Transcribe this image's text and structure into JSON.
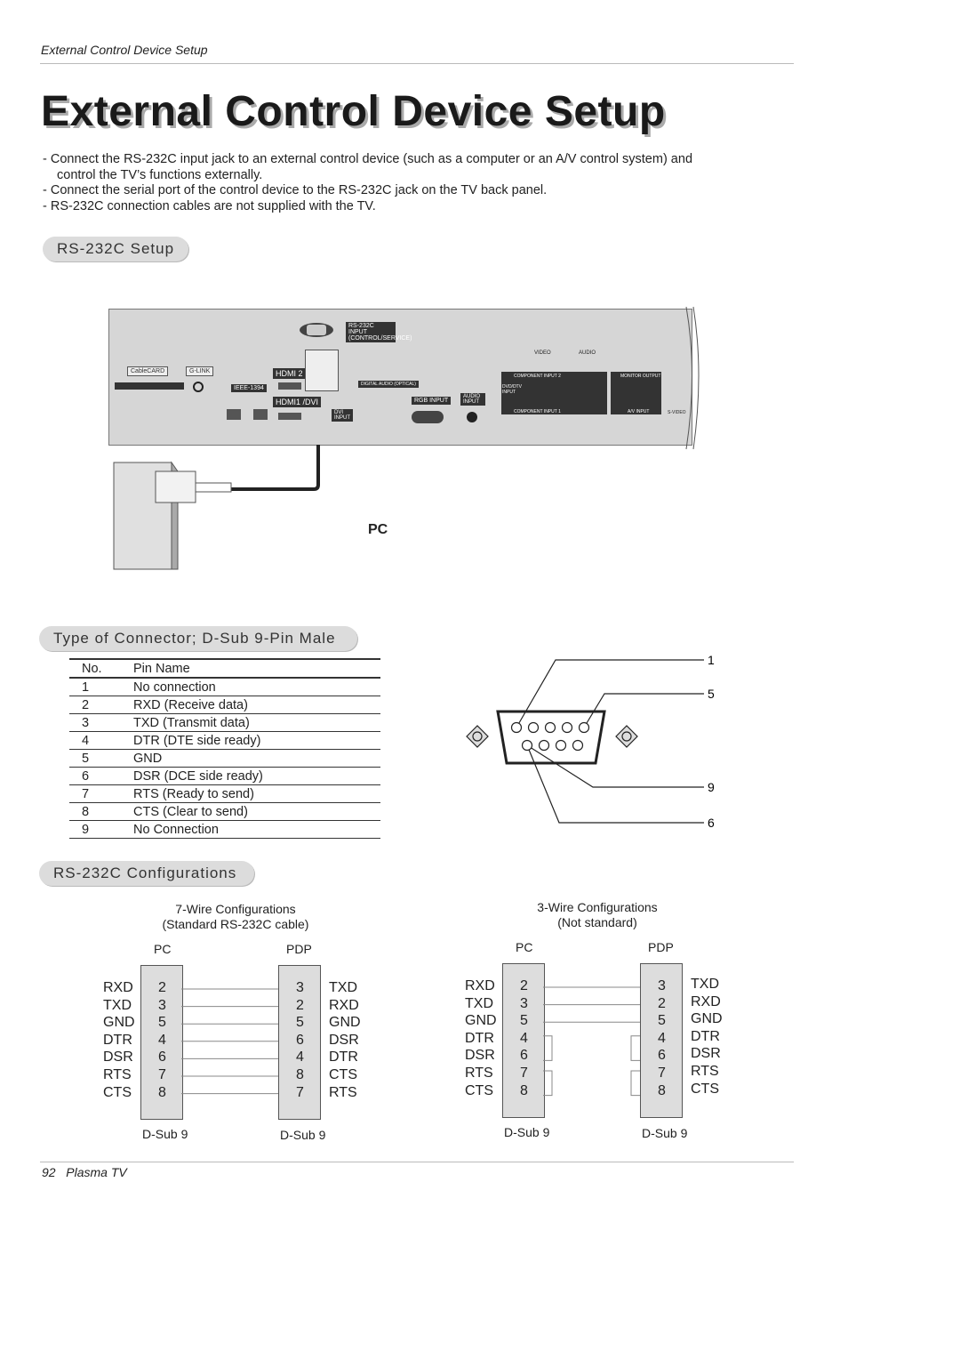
{
  "header": {
    "running_title": "External Control Device Setup"
  },
  "title": "External Control Device Setup",
  "bullets": [
    "- Connect the RS-232C input jack to an external control device (such as a computer or an A/V control system) and control the TV’s functions externally.",
    "- Connect the serial port of the control device to the RS-232C jack on the TV back panel.",
    "- RS-232C connection cables are not supplied with the TV."
  ],
  "sections": {
    "setup": "RS-232C Setup",
    "connector": "Type of Connector; D-Sub 9-Pin Male",
    "configs": "RS-232C Configurations"
  },
  "panel": {
    "rs232": "RS-232C INPUT (CONTROL/SERVICE)",
    "cablecard": "CableCARD",
    "glink": "G-LINK",
    "ieee": "IEEE-1394",
    "hdmi2": "HDMI 2",
    "hdmi1": "HDMI1 /DVI",
    "dvi": "DVI INPUT",
    "optical": "DIGITAL AUDIO (OPTICAL)",
    "rgb": "RGB INPUT",
    "audio_in": "AUDIO INPUT",
    "video": "VIDEO",
    "audio": "AUDIO",
    "comp2": "COMPONENT INPUT 2",
    "comp1": "COMPONENT INPUT 1",
    "monitor": "MONITOR OUTPUT",
    "av": "A/V INPUT",
    "svideo": "S-VIDEO",
    "dvd": "DVD/DTV INPUT"
  },
  "pc_label": "PC",
  "pin_table": {
    "headers": [
      "No.",
      "Pin Name"
    ],
    "rows": [
      [
        "1",
        "No connection"
      ],
      [
        "2",
        "RXD (Receive data)"
      ],
      [
        "3",
        "TXD (Transmit data)"
      ],
      [
        "4",
        "DTR (DTE side ready)"
      ],
      [
        "5",
        "GND"
      ],
      [
        "6",
        "DSR (DCE side ready)"
      ],
      [
        "7",
        "RTS (Ready to send)"
      ],
      [
        "8",
        "CTS (Clear to send)"
      ],
      [
        "9",
        "No Connection"
      ]
    ]
  },
  "connector_labels": [
    "1",
    "5",
    "9",
    "6"
  ],
  "config7": {
    "title": "7-Wire Configurations",
    "subtitle": "(Standard RS-232C cable)",
    "left_head": "PC",
    "right_head": "PDP",
    "left_names": [
      "RXD",
      "TXD",
      "GND",
      "DTR",
      "DSR",
      "RTS",
      "CTS"
    ],
    "left_pins": [
      "2",
      "3",
      "5",
      "4",
      "6",
      "7",
      "8"
    ],
    "right_pins": [
      "3",
      "2",
      "5",
      "6",
      "4",
      "8",
      "7"
    ],
    "right_names": [
      "TXD",
      "RXD",
      "GND",
      "DSR",
      "DTR",
      "CTS",
      "RTS"
    ],
    "left_foot": "D-Sub 9",
    "right_foot": "D-Sub 9"
  },
  "config3": {
    "title": "3-Wire Configurations",
    "subtitle": "(Not standard)",
    "left_head": "PC",
    "right_head": "PDP",
    "left_names": [
      "RXD",
      "TXD",
      "GND",
      "DTR",
      "DSR",
      "RTS",
      "CTS"
    ],
    "left_pins": [
      "2",
      "3",
      "5",
      "4",
      "6",
      "7",
      "8"
    ],
    "right_pins": [
      "3",
      "2",
      "5",
      "4",
      "6",
      "7",
      "8"
    ],
    "right_names": [
      "TXD",
      "RXD",
      "GND",
      "DTR",
      "DSR",
      "RTS",
      "CTS"
    ],
    "left_foot": "D-Sub 9",
    "right_foot": "D-Sub 9"
  },
  "footer": {
    "page": "92",
    "product": "Plasma TV"
  }
}
